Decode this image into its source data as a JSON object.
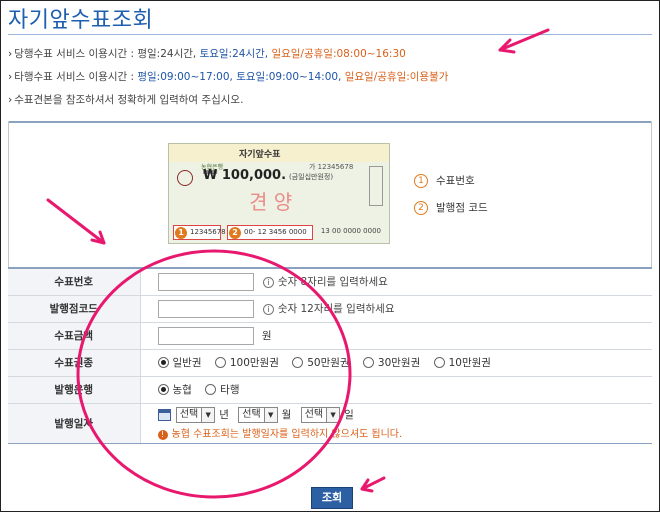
{
  "page": {
    "title": "자기앞수표조회",
    "info": {
      "line1": {
        "label": "당행수표 서비스 이용시간 : ",
        "weekday": "평일:24시간, ",
        "saturday": "토요일:24시간, ",
        "holiday": "일요일/공휴일:08:00~16:30"
      },
      "line2": {
        "label": "타행수표 서비스 이용시간 : ",
        "weekday": "평일:09:00~17:00, ",
        "saturday": "토요일:09:00~14:00, ",
        "holiday": "일요일/공휴일:이용불가"
      },
      "line3": "수표견본을 참조하셔서 정확하게 입력하여 주십시오."
    }
  },
  "cheque_sample": {
    "header": "자기앞수표",
    "number": "가 12345678",
    "bank": "농협은행",
    "amount": "₩ 100,000.",
    "amount_korean": "(금일십만원정)",
    "stamp": "견 양",
    "code1": "12345678",
    "code2": "00- 12 3456 0000",
    "code_tail": "13 00 0000 0000",
    "badge1": "1",
    "badge2": "2"
  },
  "legend": [
    {
      "num": "1",
      "label": "수표번호"
    },
    {
      "num": "2",
      "label": "발행점 코드"
    }
  ],
  "form": {
    "cheque_no": {
      "label": "수표번호",
      "value": "",
      "hint": "숫자 8자리를 입력하세요"
    },
    "branch_code": {
      "label": "발행점코드",
      "value": "",
      "hint": "숫자 12자리를 입력하세요"
    },
    "amount": {
      "label": "수표금액",
      "value": "",
      "unit": "원"
    },
    "denomination": {
      "label": "수표권종",
      "options": [
        "일반권",
        "100만원권",
        "50만원권",
        "30만원권",
        "10만원권"
      ],
      "selected": "일반권"
    },
    "issuing_bank": {
      "label": "발행은행",
      "options": [
        "농협",
        "타행"
      ],
      "selected": "농협"
    },
    "issue_date": {
      "label": "발행일자",
      "year": "선택",
      "year_unit": "년",
      "month": "선택",
      "month_unit": "월",
      "day": "선택",
      "day_unit": "일",
      "notice": "농협 수표조회는 발행일자를 입력하지 않으셔도 됩니다."
    },
    "submit": "조회"
  },
  "colors": {
    "title": "#1e5fb0",
    "accent_orange": "#d9601a",
    "annotation": "#e8186e",
    "button": "#2d5fa3"
  }
}
